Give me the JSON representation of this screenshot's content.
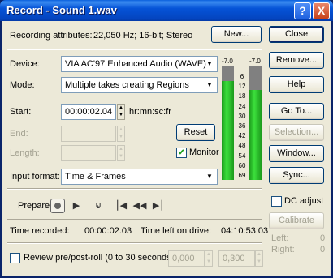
{
  "window": {
    "title": "Record - Sound 1.wav",
    "help_glyph": "?",
    "close_glyph": "X"
  },
  "header": {
    "rec_attr_label": "Recording attributes:",
    "rec_attr_value": "22,050 Hz; 16-bit; Stereo",
    "new_button": "New..."
  },
  "form": {
    "device_label": "Device:",
    "device_value": "VIA AC'97 Enhanced Audio (WAVE)",
    "mode_label": "Mode:",
    "mode_value": "Multiple takes creating Regions",
    "start_label": "Start:",
    "start_value": "00:00:02.04",
    "start_unit": "hr:mn:sc:fr",
    "end_label": "End:",
    "end_value": "",
    "length_label": "Length:",
    "length_value": "",
    "reset_button": "Reset",
    "monitor_label": "Monitor",
    "monitor_checked": true,
    "input_format_label": "Input format:",
    "input_format_value": "Time & Frames"
  },
  "meter": {
    "left_peak": "-7.0",
    "right_peak": "-7.0",
    "ticks": [
      "6",
      "12",
      "18",
      "24",
      "30",
      "36",
      "42",
      "48",
      "54",
      "60",
      "69"
    ],
    "left_level": 0.87,
    "right_level": 0.79
  },
  "transport": {
    "prepare_label": "Prepare"
  },
  "status": {
    "time_recorded_label": "Time recorded:",
    "time_recorded_value": "00:00:02.03",
    "time_left_label": "Time left on drive:",
    "time_left_value": "04:10:53:03"
  },
  "review": {
    "label": "Review pre/post-roll (0 to 30 seconds):",
    "pre_value": "0,000",
    "post_value": "0,300",
    "checked": false
  },
  "sidebar": {
    "close": "Close",
    "remove": "Remove...",
    "help": "Help",
    "goto": "Go To...",
    "selection": "Selection...",
    "window": "Window...",
    "sync": "Sync...",
    "dc_adjust": "DC adjust",
    "calibrate": "Calibrate",
    "left_label": "Left:",
    "left_value": "0",
    "right_label": "Right:",
    "right_value": "0"
  },
  "colors": {
    "meter_green": "#3ce03c",
    "titlebar": "#0553d7"
  }
}
